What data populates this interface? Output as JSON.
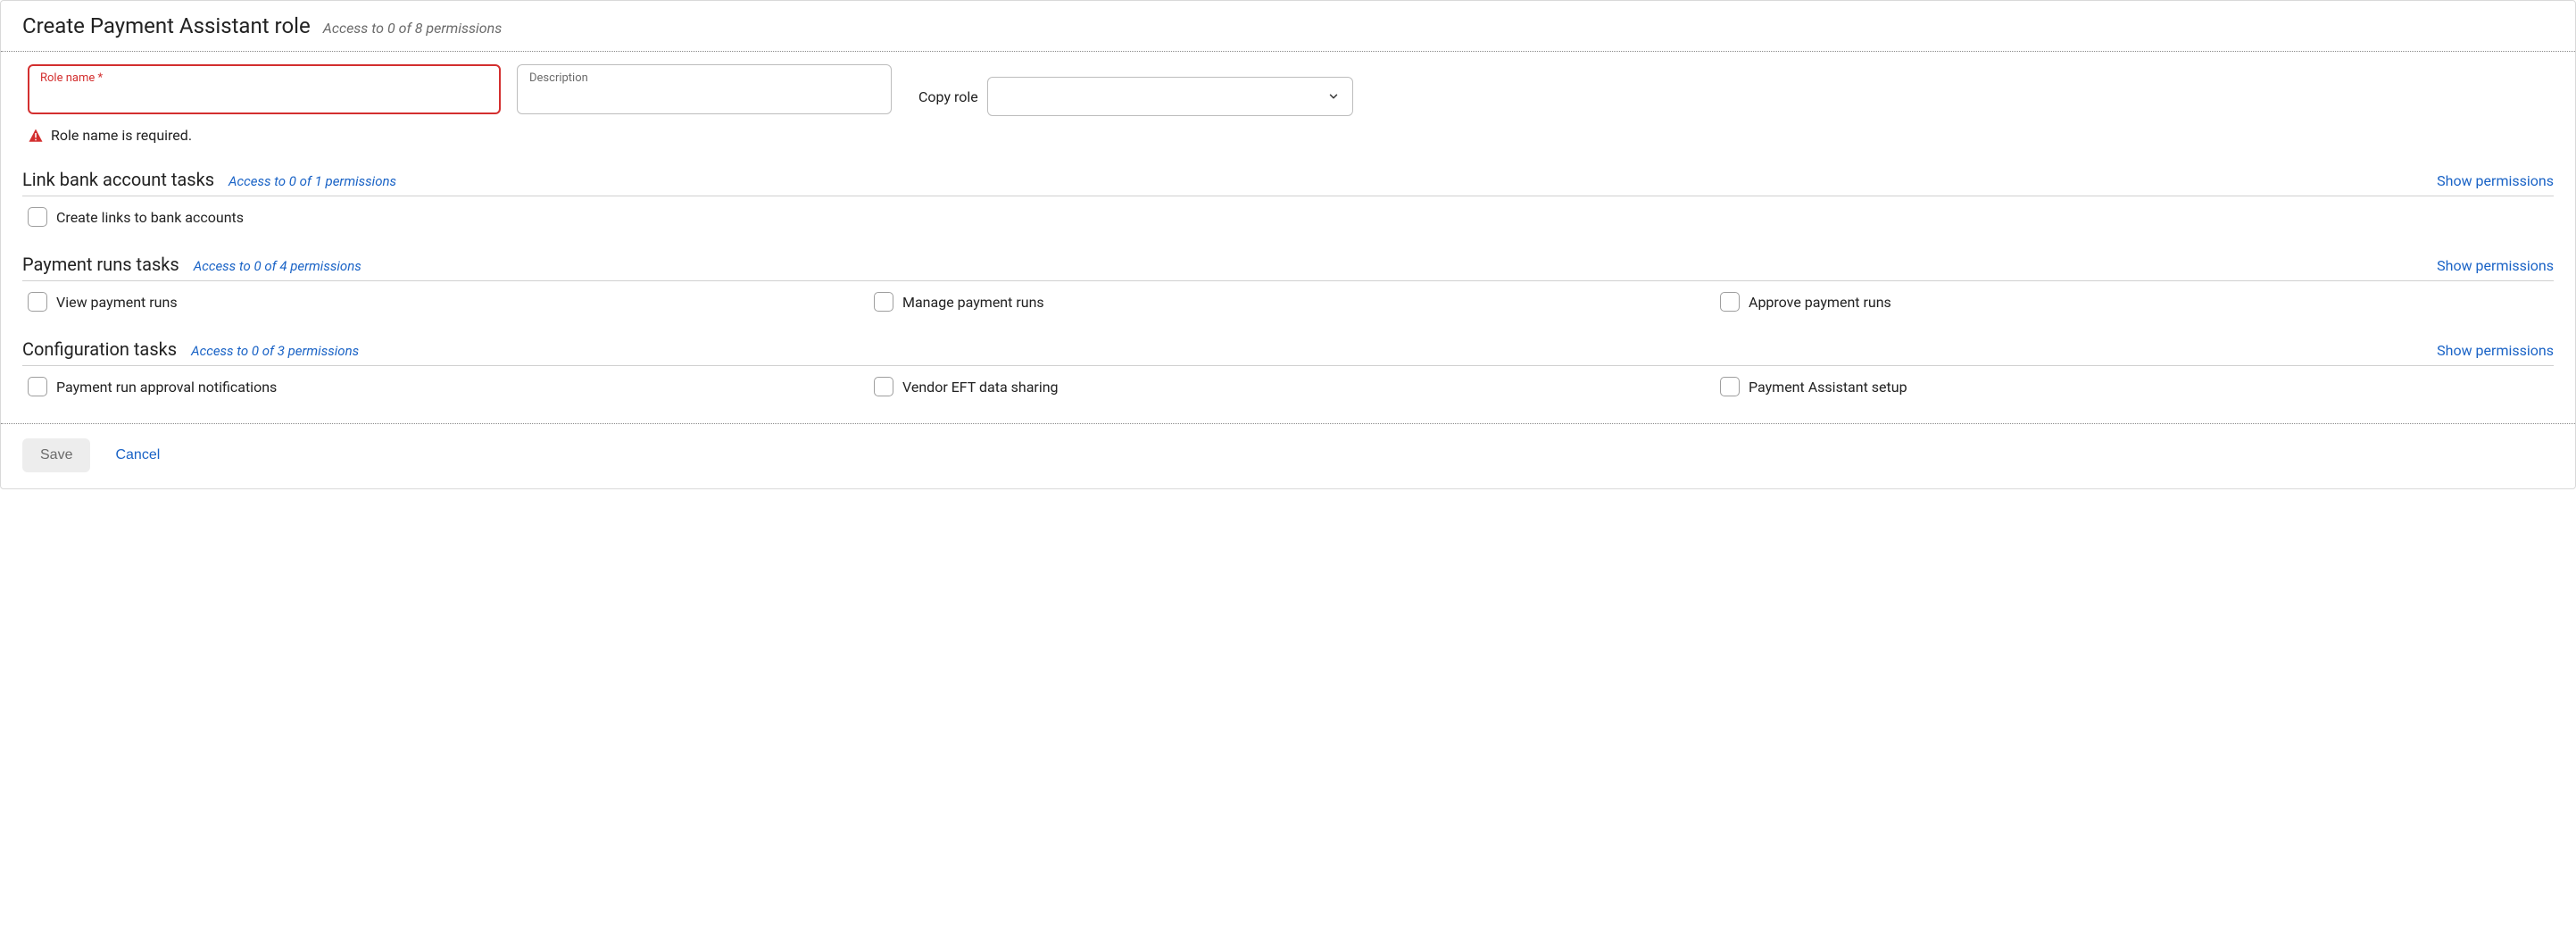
{
  "header": {
    "title": "Create Payment Assistant role",
    "subtitle": "Access to 0 of 8 permissions"
  },
  "form": {
    "role_name_label": "Role name *",
    "role_name_value": "",
    "role_name_error": "Role name is required.",
    "description_label": "Description",
    "description_value": "",
    "copy_role_label": "Copy role",
    "copy_role_value": ""
  },
  "sections": [
    {
      "title": "Link bank account tasks",
      "subtitle": "Access to 0 of 1 permissions",
      "show_link": "Show permissions",
      "permissions": [
        {
          "label": "Create links to bank accounts",
          "checked": false
        }
      ]
    },
    {
      "title": "Payment runs tasks",
      "subtitle": "Access to 0 of 4 permissions",
      "show_link": "Show permissions",
      "permissions": [
        {
          "label": "View payment runs",
          "checked": false
        },
        {
          "label": "Manage payment runs",
          "checked": false
        },
        {
          "label": "Approve payment runs",
          "checked": false
        }
      ]
    },
    {
      "title": "Configuration tasks",
      "subtitle": "Access to 0 of 3 permissions",
      "show_link": "Show permissions",
      "permissions": [
        {
          "label": "Payment run approval notifications",
          "checked": false
        },
        {
          "label": "Vendor EFT data sharing",
          "checked": false
        },
        {
          "label": "Payment Assistant setup",
          "checked": false
        }
      ]
    }
  ],
  "footer": {
    "save_label": "Save",
    "cancel_label": "Cancel"
  }
}
